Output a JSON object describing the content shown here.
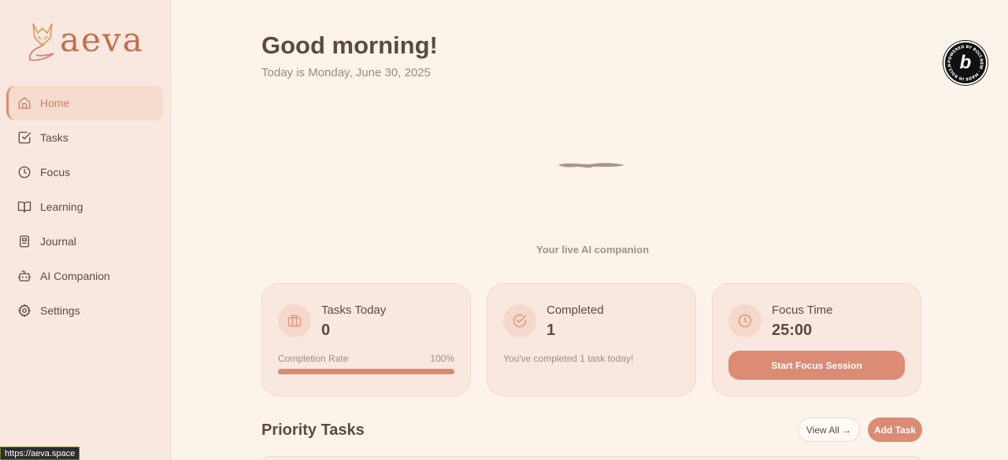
{
  "brand": {
    "name": "aeva",
    "accent": "#dc8b75"
  },
  "sidebar": {
    "items": [
      {
        "label": "Home",
        "icon": "home-icon",
        "active": true
      },
      {
        "label": "Tasks",
        "icon": "checkbox-icon"
      },
      {
        "label": "Focus",
        "icon": "clock-icon"
      },
      {
        "label": "Learning",
        "icon": "book-icon"
      },
      {
        "label": "Journal",
        "icon": "journal-icon"
      },
      {
        "label": "AI Companion",
        "icon": "bot-icon"
      },
      {
        "label": "Settings",
        "icon": "gear-icon"
      }
    ]
  },
  "status_url": "https://aeva.space",
  "header": {
    "greeting": "Good morning!",
    "date_line": "Today is Monday, June 30, 2025"
  },
  "companion": {
    "caption": "Your live AI companion"
  },
  "badge": {
    "letter": "b",
    "ring_text": "POWERED BY BOLT.NEW · MADE IN BOLT.NEW"
  },
  "cards": {
    "tasks_today": {
      "title": "Tasks Today",
      "value": "0",
      "rate_label": "Completion Rate",
      "rate_value": "100%",
      "rate_fraction": 1.0,
      "icon": "briefcase-icon"
    },
    "completed": {
      "title": "Completed",
      "value": "1",
      "note": "You've completed 1 task today!",
      "icon": "check-circle-icon"
    },
    "focus_time": {
      "title": "Focus Time",
      "value": "25:00",
      "button": "Start Focus Session",
      "icon": "clock-icon"
    }
  },
  "priority": {
    "title": "Priority Tasks",
    "view_all": "View All →",
    "add_task": "Add Task"
  }
}
